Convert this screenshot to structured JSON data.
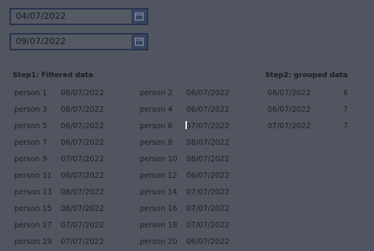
{
  "date_inputs": [
    {
      "value": "04/07/2022"
    },
    {
      "value": "09/07/2022"
    }
  ],
  "step1": {
    "title": "Step1: Filtered data",
    "rows": [
      [
        {
          "name": "person 1",
          "date": "08/07/2022"
        },
        {
          "name": "person 2",
          "date": "06/07/2022"
        }
      ],
      [
        {
          "name": "person 3",
          "date": "08/07/2022"
        },
        {
          "name": "person 4",
          "date": "06/07/2022"
        }
      ],
      [
        {
          "name": "person 5",
          "date": "06/07/2022"
        },
        {
          "name": "person 6",
          "date": "07/07/2022"
        }
      ],
      [
        {
          "name": "person 7",
          "date": "06/07/2022"
        },
        {
          "name": "person 8",
          "date": "08/07/2022"
        }
      ],
      [
        {
          "name": "person 9",
          "date": "07/07/2022"
        },
        {
          "name": "person 10",
          "date": "08/07/2022"
        }
      ],
      [
        {
          "name": "person 11",
          "date": "06/07/2022"
        },
        {
          "name": "person 12",
          "date": "06/07/2022"
        }
      ],
      [
        {
          "name": "person 13",
          "date": "08/07/2022"
        },
        {
          "name": "person 14",
          "date": "07/07/2022"
        }
      ],
      [
        {
          "name": "person 15",
          "date": "08/07/2022"
        },
        {
          "name": "person 16",
          "date": "07/07/2022"
        }
      ],
      [
        {
          "name": "person 17",
          "date": "07/07/2022"
        },
        {
          "name": "person 18",
          "date": "07/07/2022"
        }
      ],
      [
        {
          "name": "person 19",
          "date": "07/07/2022"
        },
        {
          "name": "person 20",
          "date": "06/07/2022"
        }
      ]
    ]
  },
  "step2": {
    "title": "Step2: grouped data",
    "rows": [
      {
        "date": "08/07/2022",
        "count": "6"
      },
      {
        "date": "06/07/2022",
        "count": "7"
      },
      {
        "date": "07/07/2022",
        "count": "7"
      }
    ]
  }
}
